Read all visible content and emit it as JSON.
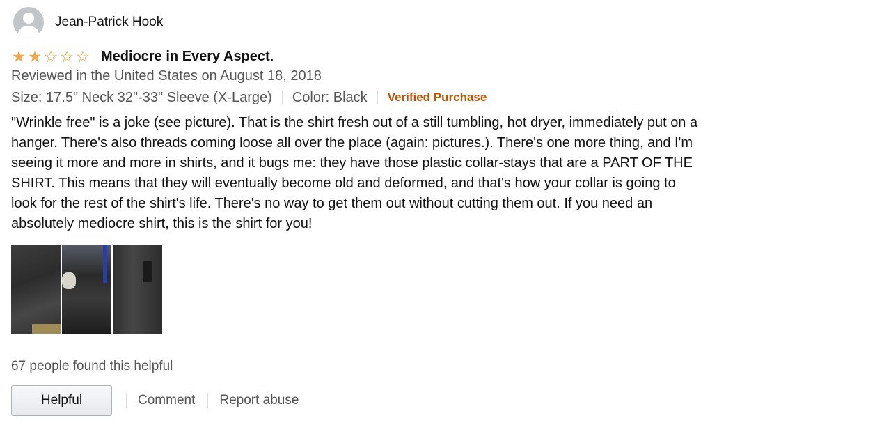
{
  "profile": {
    "name": "Jean-Patrick Hook",
    "avatar_icon": "user-silhouette-icon"
  },
  "review": {
    "rating": 2,
    "rating_max": 5,
    "star_colors": {
      "filled": "#f3a847",
      "empty": "#e59d2f"
    },
    "title": "Mediocre in Every Aspect.",
    "date_line": "Reviewed in the United States on August 18, 2018",
    "size": "Size: 17.5\" Neck 32\"-33\" Sleeve (X-Large)",
    "color": "Color: Black",
    "verified": "Verified Purchase",
    "verified_color": "#c45500",
    "body": "\"Wrinkle free\" is a joke (see picture). That is the shirt fresh out of a still tumbling, hot dryer, immediately put on a hanger. There's also threads coming loose all over the place (again: pictures.). There's one more thing, and I'm seeing it more and more in shirts, and it bugs me: they have those plastic collar-stays that are a PART OF THE SHIRT. This means that they will eventually become old and deformed, and that's how your collar is going to look for the rest of the shirt's life. There's no way to get them out without cutting them out. If you need an absolutely mediocre shirt, this is the shirt for you!",
    "images": [
      "review-image-1",
      "review-image-2",
      "review-image-3"
    ]
  },
  "footer": {
    "helpful_count": "67 people found this helpful",
    "helpful_button": "Helpful",
    "comment_link": "Comment",
    "report_link": "Report abuse"
  }
}
